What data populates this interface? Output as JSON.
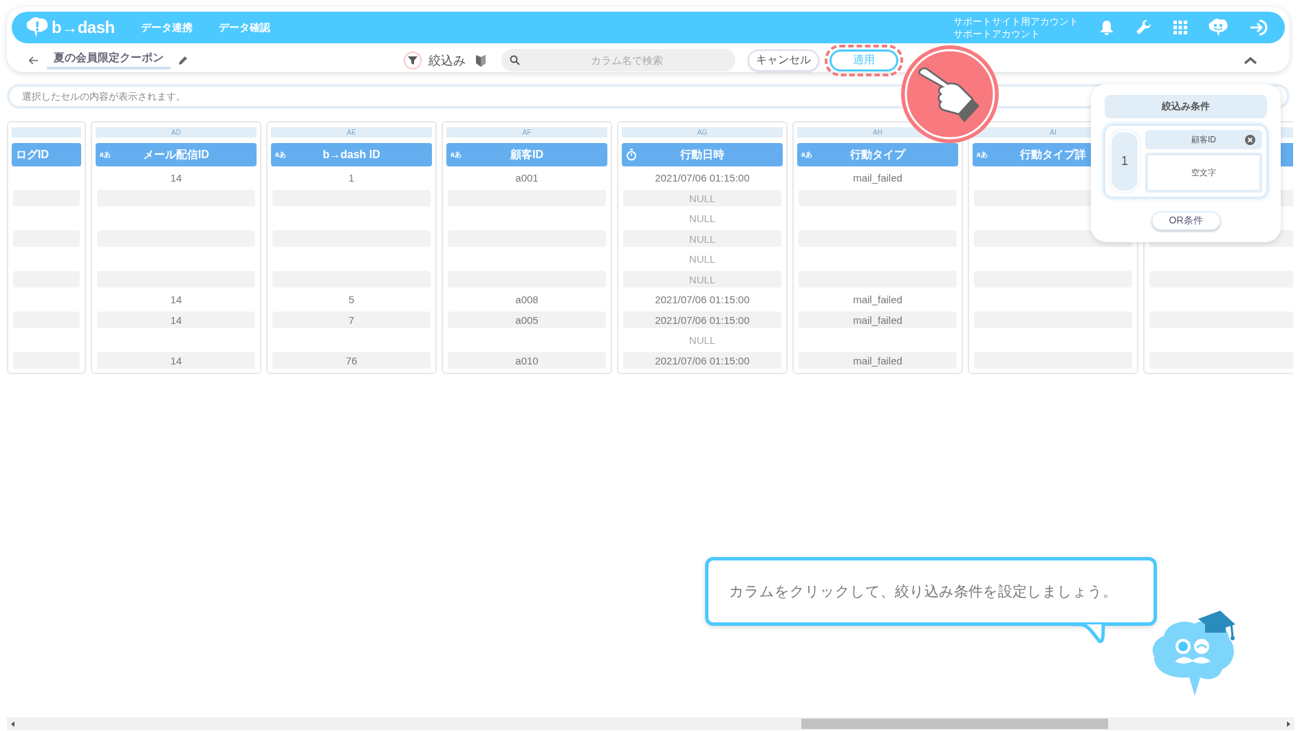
{
  "header": {
    "logo": "b→dash",
    "nav": [
      "データ連携",
      "データ確認"
    ],
    "account": [
      "サポートサイト用アカウント",
      "サポートアカウント"
    ]
  },
  "toolbar": {
    "title": "夏の会員限定クーポン",
    "filter_label": "絞込み",
    "search": {
      "placeholder": "カラム名で検索"
    },
    "buttons": [
      {
        "label": "キャンセル",
        "highlighted": false
      },
      {
        "label": "適用",
        "highlighted": true
      }
    ]
  },
  "cell_display": {
    "placeholder": "選択したセルの内容が表示されます。"
  },
  "table": {
    "columns": [
      {
        "header": "ログID",
        "cells": [
          null,
          null,
          null,
          null,
          null,
          null,
          null,
          null,
          null,
          null
        ]
      },
      {
        "letter": "AD",
        "kind": "text",
        "type_badge": "aあ",
        "header": "メール配信ID",
        "cells": [
          {
            "text": "14",
            "kind": "value"
          },
          null,
          null,
          null,
          null,
          null,
          {
            "text": "14",
            "kind": "value"
          },
          {
            "text": "14",
            "kind": "value"
          },
          null,
          {
            "text": "14",
            "kind": "value"
          }
        ]
      },
      {
        "letter": "AE",
        "kind": "text",
        "type_badge": "aあ",
        "header": "b→dash ID",
        "cells": [
          {
            "text": "1",
            "kind": "value"
          },
          null,
          null,
          null,
          null,
          null,
          {
            "text": "5",
            "kind": "value"
          },
          {
            "text": "7",
            "kind": "value"
          },
          null,
          {
            "text": "76",
            "kind": "value"
          }
        ]
      },
      {
        "letter": "AF",
        "kind": "text",
        "type_badge": "aあ",
        "header": "顧客ID",
        "cells": [
          {
            "text": "a001",
            "kind": "value"
          },
          null,
          null,
          null,
          null,
          null,
          {
            "text": "a008",
            "kind": "value"
          },
          {
            "text": "a005",
            "kind": "value"
          },
          null,
          {
            "text": "a010",
            "kind": "value"
          }
        ]
      },
      {
        "letter": "AG",
        "kind": "datetime",
        "header": "行動日時",
        "cells": [
          {
            "text": "2021/07/06 01:15:00",
            "kind": "value"
          },
          {
            "text": "NULL",
            "kind": "null"
          },
          {
            "text": "NULL",
            "kind": "null"
          },
          {
            "text": "NULL",
            "kind": "null"
          },
          {
            "text": "NULL",
            "kind": "null"
          },
          {
            "text": "NULL",
            "kind": "null"
          },
          {
            "text": "2021/07/06 01:15:00",
            "kind": "value"
          },
          {
            "text": "2021/07/06 01:15:00",
            "kind": "value"
          },
          {
            "text": "NULL",
            "kind": "null"
          },
          {
            "text": "2021/07/06 01:15:00",
            "kind": "value"
          }
        ]
      },
      {
        "letter": "AH",
        "kind": "text",
        "type_badge": "aあ",
        "header": "行動タイプ",
        "cells": [
          {
            "text": "mail_failed",
            "kind": "value"
          },
          null,
          null,
          null,
          null,
          null,
          {
            "text": "mail_failed",
            "kind": "value"
          },
          {
            "text": "mail_failed",
            "kind": "value"
          },
          null,
          {
            "text": "mail_failed",
            "kind": "value"
          }
        ]
      },
      {
        "letter": "AI",
        "kind": "text",
        "type_badge": "aあ",
        "header": "行動タイプ詳",
        "cells": [
          null,
          null,
          null,
          null,
          null,
          null,
          null,
          null,
          null,
          null
        ]
      },
      {
        "cells": [
          null,
          null,
          null,
          null,
          null,
          null,
          null,
          null,
          null,
          null
        ]
      }
    ]
  },
  "filter_panel": {
    "title": "絞込み条件",
    "conditions": [
      {
        "number": "1",
        "column": "顧客ID",
        "value": "空文字"
      }
    ],
    "or_button": "OR条件"
  },
  "guide": {
    "message": "カラムをクリックして、絞り込み条件を設定しましょう。"
  }
}
